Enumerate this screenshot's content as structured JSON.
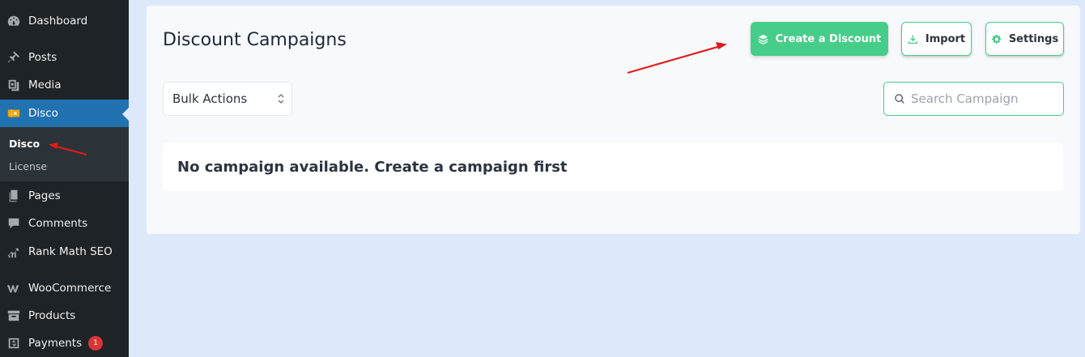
{
  "sidebar": {
    "items": [
      {
        "label": "Dashboard",
        "icon": "dashboard-icon"
      },
      {
        "label": "Posts",
        "icon": "pin-icon"
      },
      {
        "label": "Media",
        "icon": "media-icon"
      },
      {
        "label": "Disco",
        "icon": "disco-icon",
        "active": true
      },
      {
        "label": "Pages",
        "icon": "pages-icon"
      },
      {
        "label": "Comments",
        "icon": "comment-icon"
      },
      {
        "label": "Rank Math SEO",
        "icon": "rankmath-icon"
      },
      {
        "label": "WooCommerce",
        "icon": "woocommerce-icon"
      },
      {
        "label": "Products",
        "icon": "archive-icon"
      },
      {
        "label": "Payments",
        "icon": "payments-icon",
        "badge": "1"
      }
    ],
    "submenu": [
      {
        "label": "Disco",
        "current": true
      },
      {
        "label": "License"
      }
    ]
  },
  "main": {
    "title": "Discount Campaigns",
    "buttons": {
      "create": "Create a Discount",
      "import": "Import",
      "settings": "Settings"
    },
    "bulk_actions": {
      "selected": "Bulk Actions"
    },
    "search": {
      "placeholder": "Search Campaign",
      "value": ""
    },
    "empty_message": "No campaign available. Create a campaign first"
  },
  "colors": {
    "accent": "#46cd8a",
    "sidebar_bg": "#1d2327",
    "active_menu": "#2271b1",
    "page_bg": "#dde9fb",
    "annotation": "#e01b1b"
  }
}
